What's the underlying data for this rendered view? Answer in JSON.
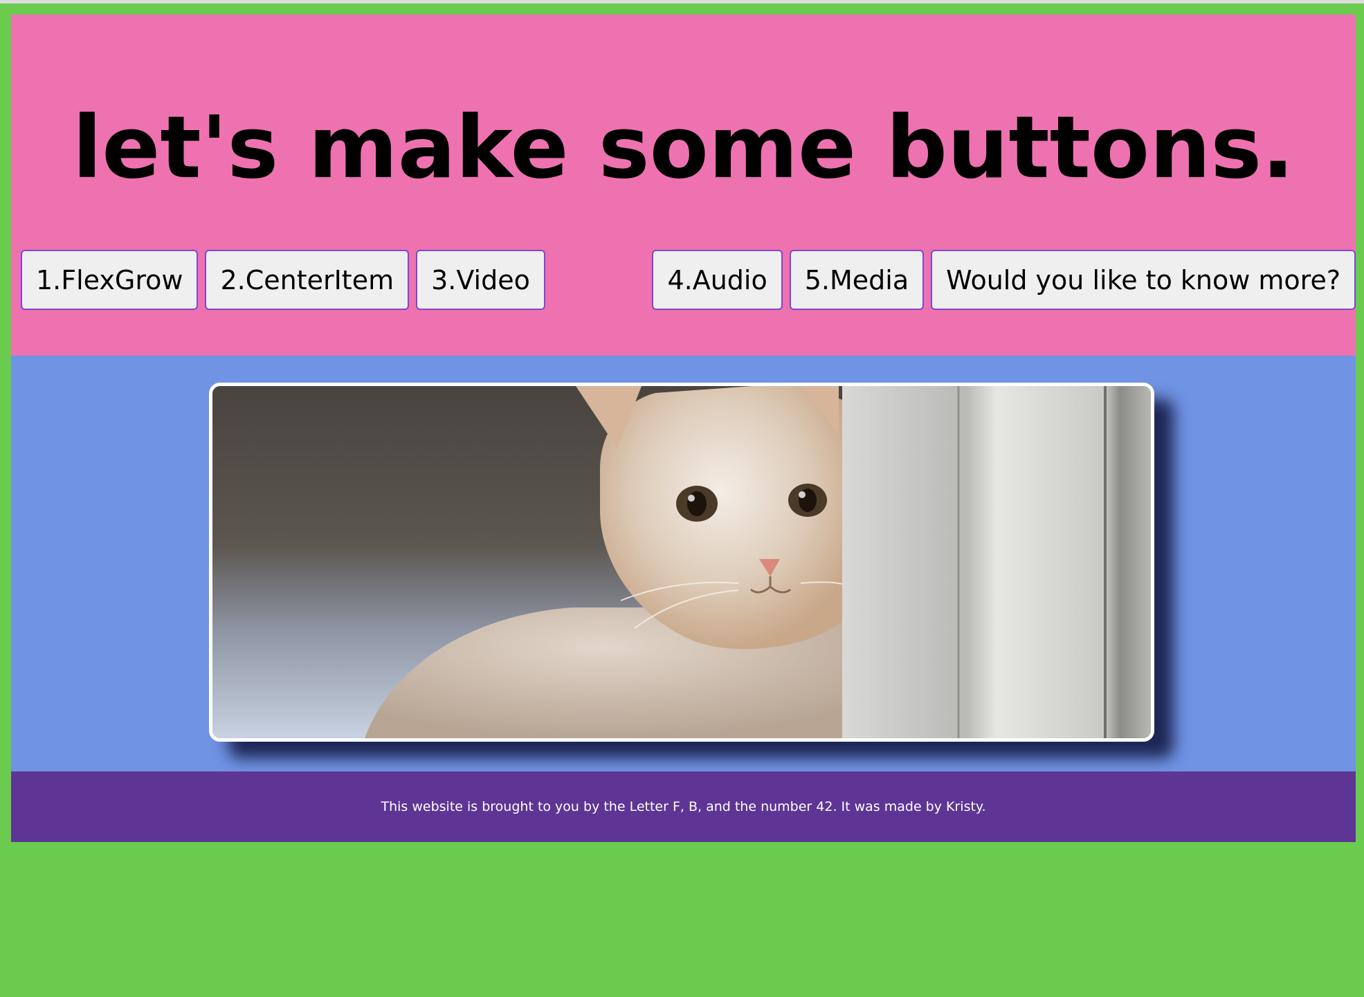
{
  "header": {
    "title": "let's make some buttons."
  },
  "nav": {
    "buttons": [
      {
        "label": "1.FlexGrow"
      },
      {
        "label": "2.CenterItem"
      },
      {
        "label": "3.Video"
      },
      {
        "label": "4.Audio"
      },
      {
        "label": "5.Media"
      },
      {
        "label": "Would you like to know more?"
      }
    ]
  },
  "main": {
    "image": {
      "alt": "kitten"
    }
  },
  "footer": {
    "text": "This website is brought to you by the Letter F, B, and the number 42. It was made by Kristy."
  },
  "colors": {
    "page_background": "#6acb4f",
    "header_background": "#ee72b0",
    "main_background": "#7093e4",
    "footer_background": "#5e3595",
    "button_border": "#7b45d6",
    "button_background": "#efefef"
  }
}
